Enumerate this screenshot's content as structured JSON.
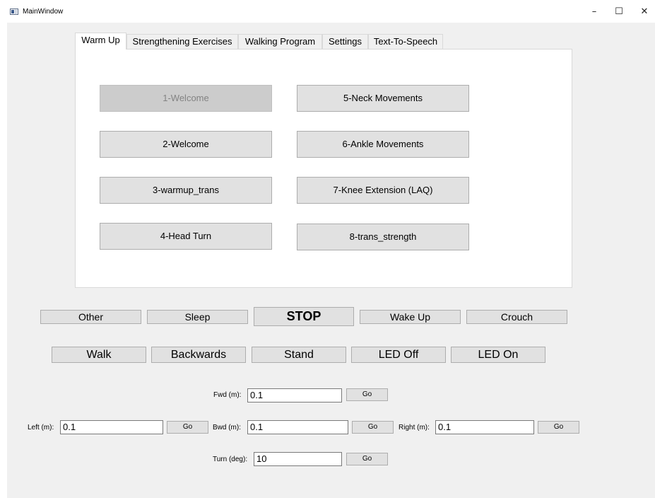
{
  "window": {
    "title": "MainWindow",
    "minimize_glyph": "–",
    "maximize_glyph": "☐",
    "close_glyph": "✕"
  },
  "tabs": [
    {
      "label": "Warm Up",
      "active": true
    },
    {
      "label": "Strengthening Exercises",
      "active": false
    },
    {
      "label": "Walking Program",
      "active": false
    },
    {
      "label": "Settings",
      "active": false
    },
    {
      "label": "Text-To-Speech",
      "active": false
    }
  ],
  "warmup": {
    "buttons": [
      {
        "label": "1-Welcome",
        "enabled": false
      },
      {
        "label": "2-Welcome",
        "enabled": true
      },
      {
        "label": "3-warmup_trans",
        "enabled": true
      },
      {
        "label": "4-Head Turn",
        "enabled": true
      },
      {
        "label": "5-Neck Movements",
        "enabled": true
      },
      {
        "label": "6-Ankle Movements",
        "enabled": true
      },
      {
        "label": "7-Knee Extension (LAQ)",
        "enabled": true
      },
      {
        "label": "8-trans_strength",
        "enabled": true
      }
    ]
  },
  "controls": {
    "row1": [
      "Other",
      "Sleep",
      "STOP",
      "Wake Up",
      "Crouch"
    ],
    "row2": [
      "Walk",
      "Backwards",
      "Stand",
      "LED Off",
      "LED On"
    ]
  },
  "movement": {
    "fwd": {
      "label": "Fwd (m):",
      "value": "0.1",
      "go": "Go"
    },
    "bwd": {
      "label": "Bwd (m):",
      "value": "0.1",
      "go": "Go"
    },
    "left": {
      "label": "Left (m):",
      "value": "0.1",
      "go": "Go"
    },
    "right": {
      "label": "Right (m):",
      "value": "0.1",
      "go": "Go"
    },
    "turn": {
      "label": "Turn (deg):",
      "value": "10",
      "go": "Go"
    }
  }
}
